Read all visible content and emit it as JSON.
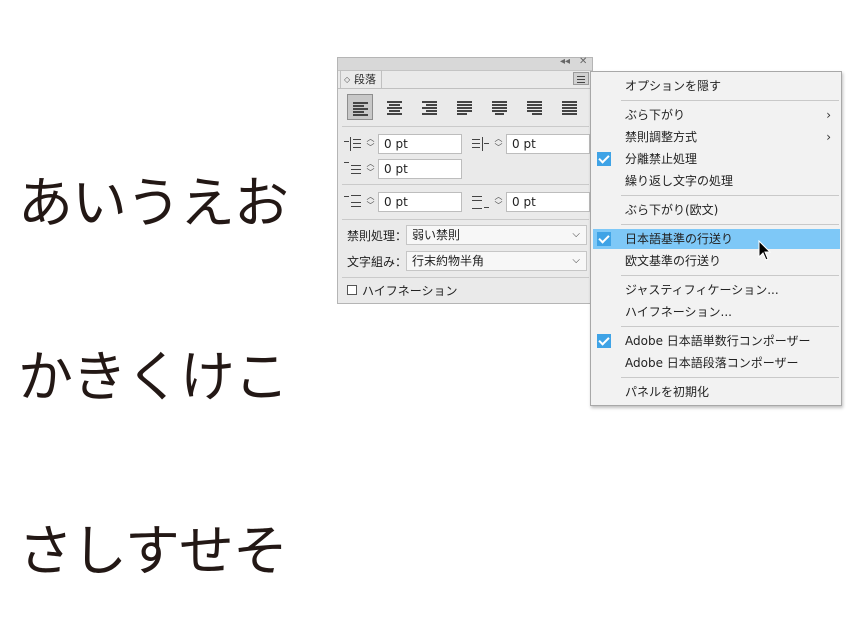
{
  "sample_text": {
    "line1": "あいうえお",
    "line2": "かきくけこ",
    "line3": "さしすせそ"
  },
  "panel": {
    "collapse_icon": "double-left-arrow-icon",
    "close_icon": "close-icon",
    "tab_label": "段落",
    "menu_icon": "hamburger-menu-icon",
    "alignment_buttons": [
      "align-left",
      "align-center",
      "align-right",
      "justify-last-left",
      "justify-last-center",
      "justify-last-right",
      "justify-all"
    ],
    "selected_alignment": "align-left",
    "left_indent": "0 pt",
    "right_indent": "0 pt",
    "first_line_indent": "0 pt",
    "space_before": "0 pt",
    "space_after": "0 pt",
    "kinsoku_label": "禁則処理：",
    "kinsoku_value": "弱い禁則",
    "mojikumi_label": "文字組み：",
    "mojikumi_value": "行末約物半角",
    "hyphenation_label": "ハイフネーション",
    "hyphenation_checked": false
  },
  "menu": {
    "hide_options": "オプションを隠す",
    "burasagari": "ぶら下がり",
    "kinsoku_method": "禁則調整方式",
    "bunri_kinshi": "分離禁止処理",
    "repeat_char": "繰り返し文字の処理",
    "burasagari_roman": "ぶら下がり(欧文)",
    "japanese_leading": "日本語基準の行送り",
    "roman_leading": "欧文基準の行送り",
    "justification": "ジャスティフィケーション...",
    "hyphenation": "ハイフネーション...",
    "single_line_composer": "Adobe 日本語単数行コンポーザー",
    "paragraph_composer": "Adobe 日本語段落コンポーザー",
    "reset_panel": "パネルを初期化",
    "highlight_color": "#7ec8f7",
    "check_color": "#3fa3e6"
  }
}
